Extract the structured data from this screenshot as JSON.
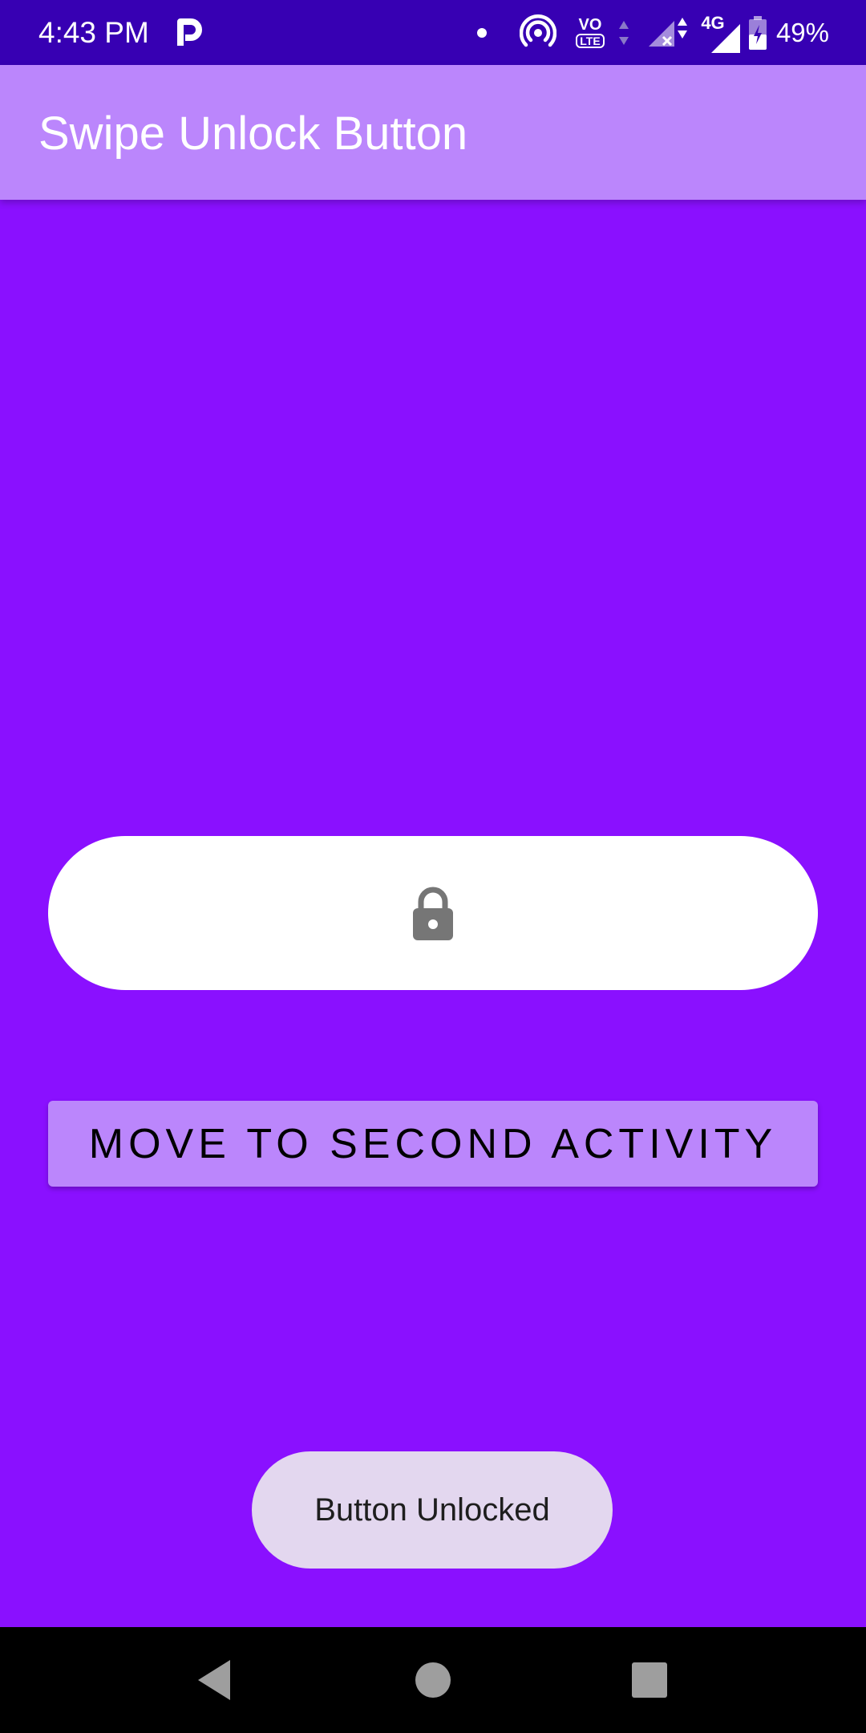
{
  "status_bar": {
    "time": "4:43 PM",
    "battery_percent": "49%",
    "network_label": "4G",
    "volte_label_top": "VO",
    "volte_label_bottom": "LTE",
    "app_badge_letter": "P",
    "icons": [
      "parking-icon",
      "dot-icon",
      "hotspot-icon",
      "volte-icon",
      "data-arrows-icon",
      "signal-icon",
      "battery-icon"
    ]
  },
  "app_bar": {
    "title": "Swipe Unlock Button",
    "color": "#bb86fc"
  },
  "swipe_button": {
    "icon": "lock-icon",
    "track_color": "#ffffff"
  },
  "action_button": {
    "label": "MOVE TO SECOND ACTIVITY",
    "color": "#bb86fc"
  },
  "toast": {
    "message": "Button Unlocked"
  },
  "nav_bar": {
    "buttons": [
      "back-icon",
      "home-icon",
      "recents-icon"
    ]
  },
  "colors": {
    "background": "#8a10ff",
    "status_bar": "#3700b3",
    "toast_bg": "#e3d7ef"
  }
}
